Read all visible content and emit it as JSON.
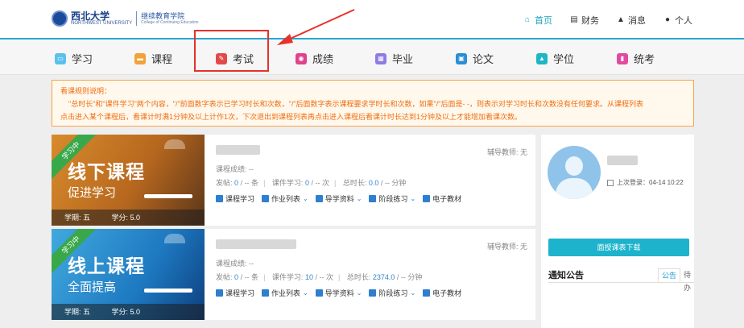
{
  "header": {
    "logo_name": "西北大学",
    "logo_sub": "NORTHWEST UNIVERSITY",
    "college": "继续教育学院",
    "college_en": "College of Continuing Education",
    "nav": [
      {
        "label": "首页",
        "icon": "home-icon"
      },
      {
        "label": "财务",
        "icon": "finance-icon"
      },
      {
        "label": "消息",
        "icon": "bell-icon"
      },
      {
        "label": "个人",
        "icon": "user-icon"
      }
    ]
  },
  "menu": [
    {
      "label": "学习",
      "color": "#5bc1ec"
    },
    {
      "label": "课程",
      "color": "#f3a13a"
    },
    {
      "label": "考试",
      "color": "#e24a4a"
    },
    {
      "label": "成绩",
      "color": "#e0428f"
    },
    {
      "label": "毕业",
      "color": "#8f7ce0"
    },
    {
      "label": "论文",
      "color": "#2a8ed6"
    },
    {
      "label": "学位",
      "color": "#1cb6c7"
    },
    {
      "label": "统考",
      "color": "#e24aa2"
    }
  ],
  "notice": {
    "title": "看课规则说明：",
    "line1": "\"总时长\"和\"课件学习\"两个内容，\"/\"前面数字表示已学习时长和次数，\"/\"后面数字表示课程要求学时长和次数，如果\"/\"后面是- -，则表示对学习时长和次数没有任何要求。从课程列表",
    "line2": "点击进入某个课程后，看课计时满1分钟及以上计作1次，下次退出到课程列表再点击进入课程后看课计时长达到1分钟及以上才能增加看课次数。"
  },
  "courses": [
    {
      "ribbon": "学习中",
      "title": "线下课程",
      "subtitle": "促进学习",
      "term": "学期: 五",
      "credit": "学分: 5.0",
      "tutor": "辅导教师: 无",
      "score": "课程成绩: --",
      "post_label": "发帖:",
      "post_val": "0",
      "post_req": "/ -- 条",
      "cw_label": "课件学习:",
      "cw_val": "0",
      "cw_req": "/ -- 次",
      "time_label": "总时长:",
      "time_val": "0.0",
      "time_req": "/ -- 分钟"
    },
    {
      "ribbon": "学习中",
      "title": "线上课程",
      "subtitle": "全面提高",
      "term": "学期: 五",
      "credit": "学分: 5.0",
      "tutor": "辅导教师: 无",
      "score": "课程成绩: --",
      "post_label": "发帖:",
      "post_val": "0",
      "post_req": "/ -- 条",
      "cw_label": "课件学习:",
      "cw_val": "10",
      "cw_req": "/ -- 次",
      "time_label": "总时长:",
      "time_val": "2374.0",
      "time_req": "/ -- 分钟"
    }
  ],
  "actions": [
    "课程学习",
    "作业列表",
    "导学资料",
    "阶段练习",
    "电子教材"
  ],
  "side": {
    "last_login": "上次登录：04-14 10:22",
    "download": "面授课表下载",
    "notice_title": "通知公告",
    "tab1": "公告",
    "tab2": "待办"
  }
}
